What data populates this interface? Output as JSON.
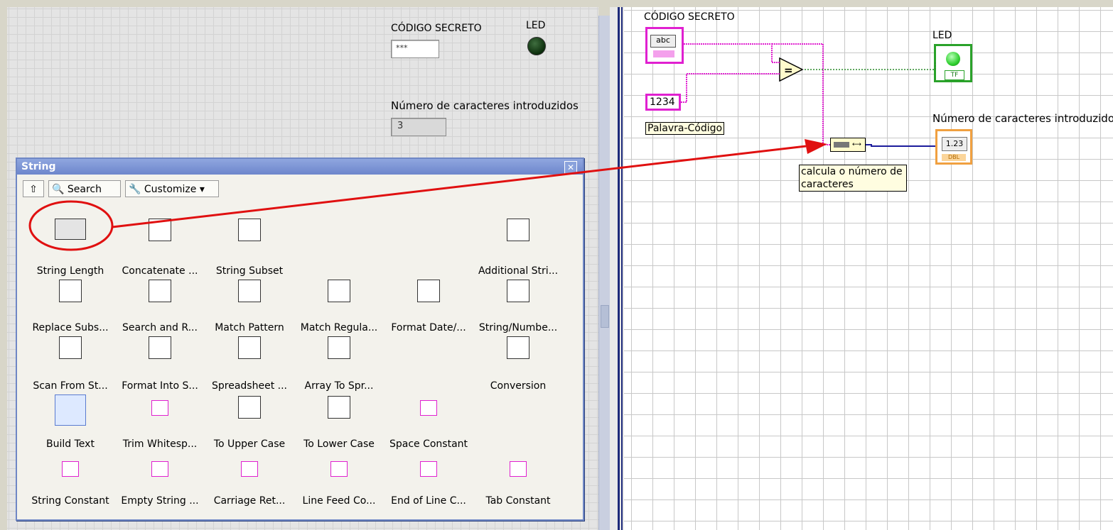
{
  "front_panel": {
    "codigo_label": "CÓDIGO SECRETO",
    "codigo_value": "***",
    "led_label": "LED",
    "numero_label": "Número de caracteres introduzidos",
    "numero_value": "3"
  },
  "palette": {
    "title": "String",
    "toolbar": {
      "up_label": "⇧",
      "search_label": "Search",
      "customize_label": "Customize ▾"
    },
    "items": [
      {
        "label": "String Length",
        "icon": "string-length-icon"
      },
      {
        "label": "Concatenate ...",
        "icon": "concatenate-icon"
      },
      {
        "label": "String Subset",
        "icon": "string-subset-icon"
      },
      {
        "label": "Additional Stri...",
        "icon": "additional-string-icon"
      },
      {
        "label": "Replace Subs...",
        "icon": "replace-substring-icon"
      },
      {
        "label": "Search and R...",
        "icon": "search-replace-icon"
      },
      {
        "label": "Match Pattern",
        "icon": "match-pattern-icon"
      },
      {
        "label": "Match Regula...",
        "icon": "match-regex-icon"
      },
      {
        "label": "Format Date/...",
        "icon": "format-date-icon"
      },
      {
        "label": "String/Numbe...",
        "icon": "string-number-icon"
      },
      {
        "label": "Scan From St...",
        "icon": "scan-from-string-icon"
      },
      {
        "label": "Format Into S...",
        "icon": "format-into-string-icon"
      },
      {
        "label": "Spreadsheet ...",
        "icon": "spreadsheet-icon"
      },
      {
        "label": "Array To Spr...",
        "icon": "array-to-spreadsheet-icon"
      },
      {
        "label": "Conversion",
        "icon": "conversion-icon"
      },
      {
        "label": "Build Text",
        "icon": "build-text-icon"
      },
      {
        "label": "Trim Whitesp...",
        "icon": "trim-whitespace-icon"
      },
      {
        "label": "To Upper Case",
        "icon": "upper-case-icon"
      },
      {
        "label": "To Lower Case",
        "icon": "lower-case-icon"
      },
      {
        "label": "Space Constant",
        "icon": "space-constant-icon"
      },
      {
        "label": "String Constant",
        "icon": "string-constant-icon"
      },
      {
        "label": "Empty String ...",
        "icon": "empty-string-icon"
      },
      {
        "label": "Carriage Ret...",
        "icon": "carriage-return-icon"
      },
      {
        "label": "Line Feed Co...",
        "icon": "line-feed-icon"
      },
      {
        "label": "End of Line C...",
        "icon": "end-of-line-icon"
      },
      {
        "label": "Tab Constant",
        "icon": "tab-constant-icon"
      }
    ]
  },
  "block_diagram": {
    "codigo_label": "CÓDIGO SECRETO",
    "codigo_terminal": "abc",
    "led_label": "LED",
    "led_terminal": "TF",
    "constant_value": "1234",
    "constant_label": "Palavra-Código",
    "numero_label": "Número de caracteres introduzidos",
    "numero_terminal": "1.23",
    "numero_type": "DBL",
    "comment": "calcula o número de caracteres",
    "equal_symbol": "="
  },
  "colors": {
    "string_wire": "#e020d0",
    "numeric_wire": "#1c1c9c",
    "bool_wire": "#2a8a2a",
    "arrow": "#e01010",
    "palette_title": "#6d86cc"
  }
}
